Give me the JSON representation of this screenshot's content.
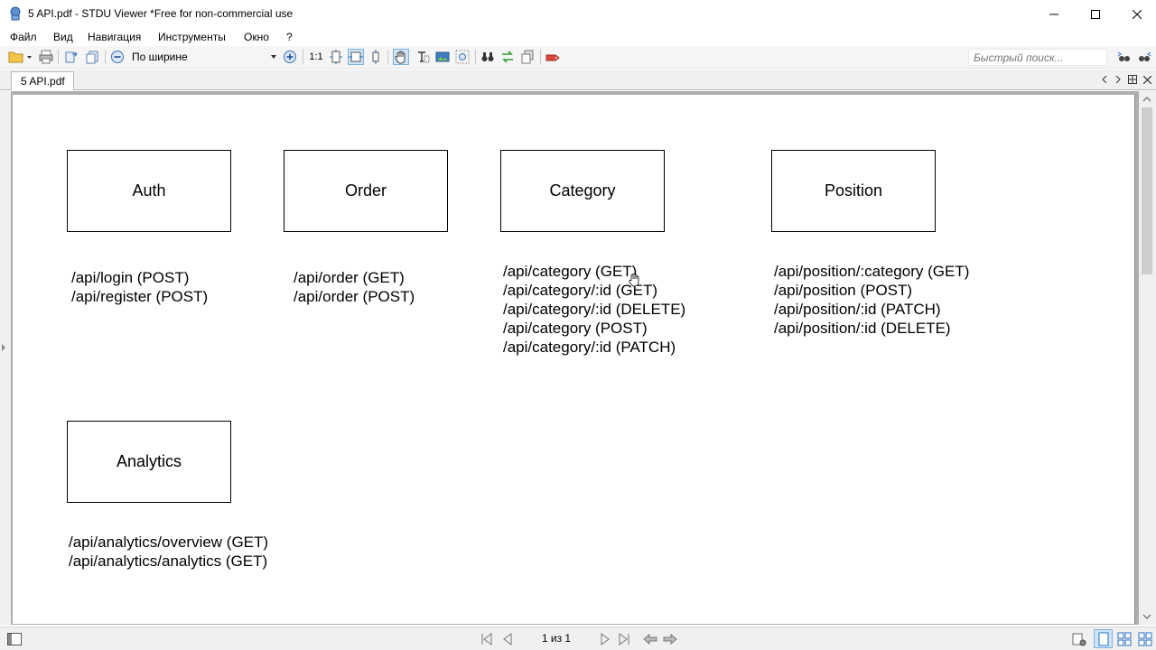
{
  "window": {
    "title": "5 API.pdf - STDU Viewer *Free for non-commercial use"
  },
  "menu": {
    "items": [
      {
        "label": "Файл"
      },
      {
        "label": "Вид"
      },
      {
        "label": "Навигация"
      },
      {
        "label": "Инструменты"
      },
      {
        "label": "Окно"
      },
      {
        "label": "?"
      }
    ]
  },
  "toolbar": {
    "zoom_mode": "По ширине",
    "actual_size_label": "1:1",
    "quick_search_placeholder": "Быстрый поиск..."
  },
  "tabs": {
    "active_doc": "5 API.pdf"
  },
  "document": {
    "boxes": [
      {
        "label": "Auth",
        "endpoints": [
          "/api/login (POST)",
          "/api/register (POST)"
        ]
      },
      {
        "label": "Order",
        "endpoints": [
          "/api/order (GET)",
          "/api/order (POST)"
        ]
      },
      {
        "label": "Category",
        "endpoints": [
          "/api/category (GET)",
          "/api/category/:id (GET)",
          "/api/category/:id (DELETE)",
          "/api/category (POST)",
          "/api/category/:id (PATCH)"
        ]
      },
      {
        "label": "Position",
        "endpoints": [
          "/api/position/:category (GET)",
          "/api/position (POST)",
          "/api/position/:id (PATCH)",
          "/api/position/:id (DELETE)"
        ]
      },
      {
        "label": "Analytics",
        "endpoints": [
          "/api/analytics/overview (GET)",
          "/api/analytics/analytics (GET)"
        ]
      }
    ]
  },
  "status": {
    "page_indicator": "1 из 1"
  },
  "colors": {
    "accent": "#1e73be",
    "active_bg": "#cde4f7",
    "doc_bg": "#aeaeae"
  }
}
